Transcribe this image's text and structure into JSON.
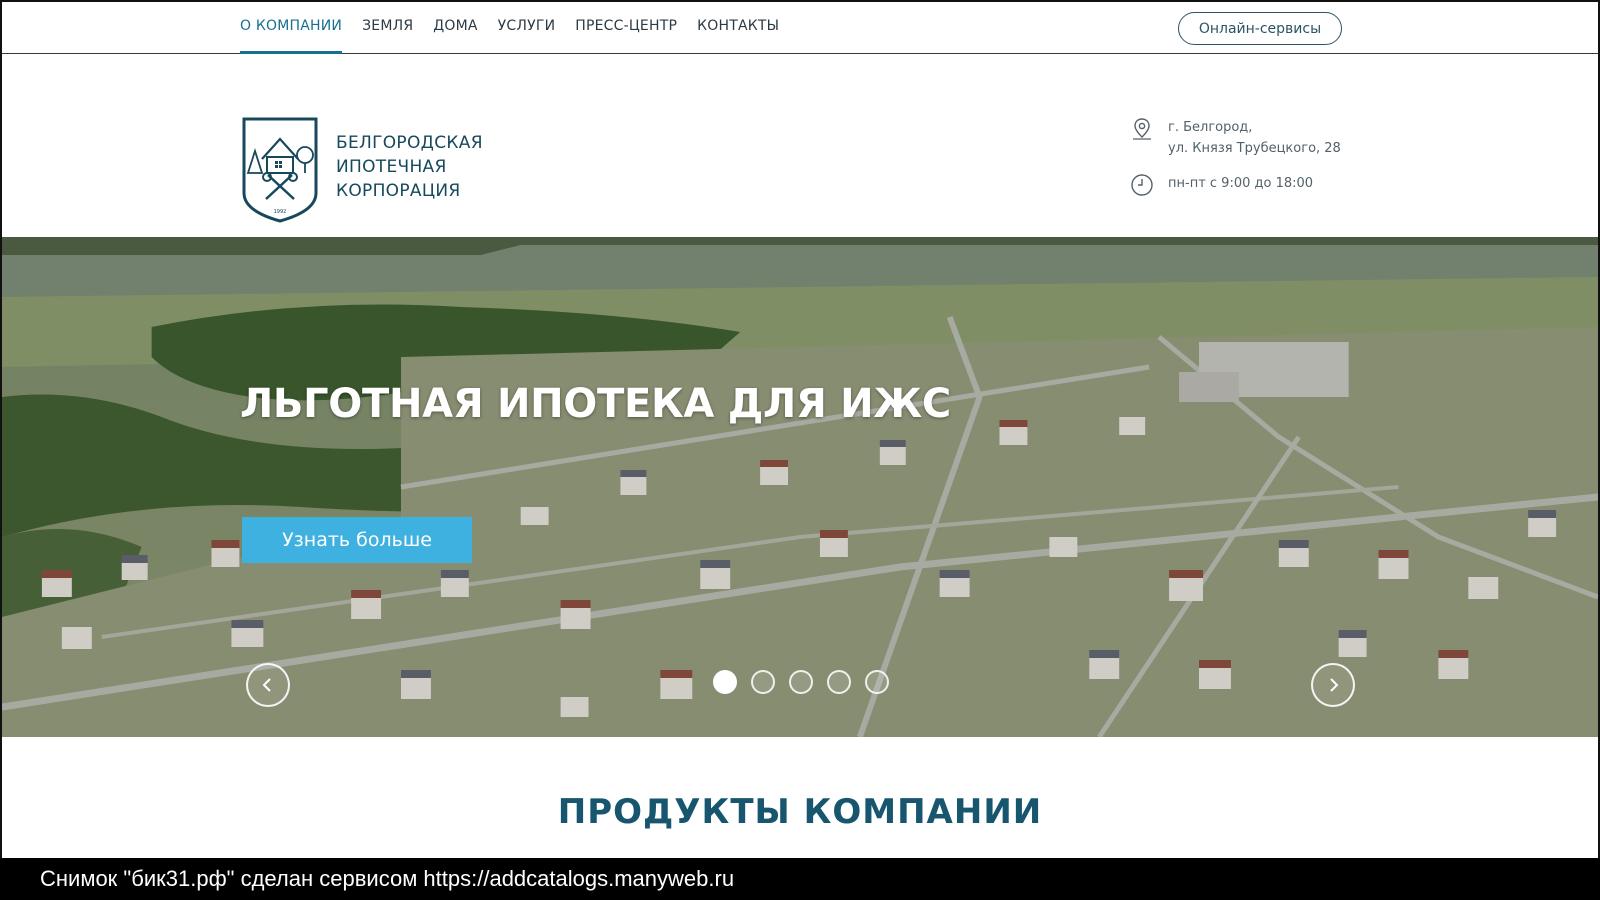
{
  "nav": {
    "items": [
      {
        "label": "О КОМПАНИИ",
        "active": true
      },
      {
        "label": "ЗЕМЛЯ",
        "active": false
      },
      {
        "label": "ДОМА",
        "active": false
      },
      {
        "label": "УСЛУГИ",
        "active": false
      },
      {
        "label": "ПРЕСС-ЦЕНТР",
        "active": false
      },
      {
        "label": "КОНТАКТЫ",
        "active": false
      }
    ],
    "online_services_label": "Онлайн-сервисы"
  },
  "header": {
    "brand_line1": "БЕЛГОРОДСКАЯ",
    "brand_line2": "ИПОТЕЧНАЯ",
    "brand_line3": "КОРПОРАЦИЯ",
    "logo_year": "1992",
    "address_line1": "г. Белгород,",
    "address_line2": "ул. Князя Трубецкого, 28",
    "hours": "пн-пт с 9:00 до 18:00",
    "icons": {
      "address": "location-pin-icon",
      "hours": "clock-icon"
    }
  },
  "hero": {
    "title": "ЛЬГОТНАЯ ИПОТЕКА ДЛЯ ИЖС",
    "button_label": "Узнать больше",
    "slide_count": 5,
    "active_slide": 1
  },
  "products": {
    "title": "ПРОДУКТЫ КОМПАНИИ"
  },
  "caption": {
    "text": "Снимок \"бик31.рф\" сделан сервисом https://addcatalogs.manyweb.ru"
  },
  "colors": {
    "accent": "#17708e",
    "button": "#3fb1e1",
    "brand_text": "#17485c"
  }
}
